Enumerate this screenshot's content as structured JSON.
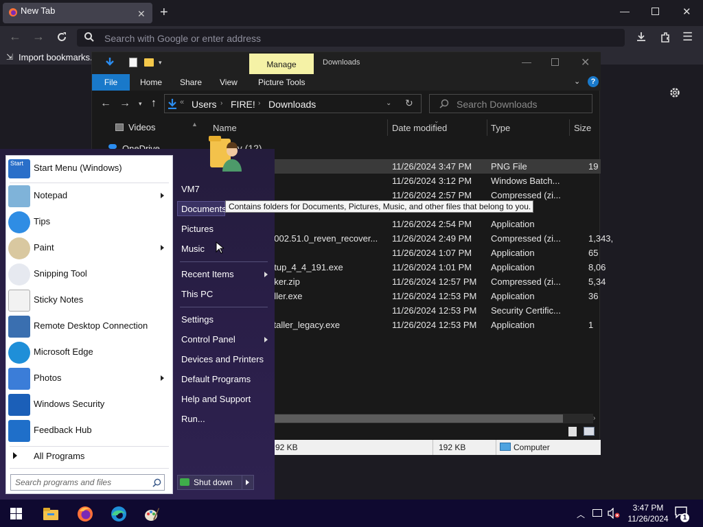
{
  "browser": {
    "tab_title": "New Tab",
    "url_placeholder": "Search with Google or enter address",
    "bookmark": "Import bookmarks..."
  },
  "explorer": {
    "ribbon_context": "Manage",
    "title": "Downloads",
    "tabs": [
      "File",
      "Home",
      "Share",
      "View",
      "Picture Tools"
    ],
    "breadcrumb": [
      "Users",
      "FIRE!",
      "Downloads"
    ],
    "search_placeholder": "Search Downloads",
    "nav": [
      "Videos",
      "OneDrive"
    ],
    "columns": [
      "Name",
      "Date modified",
      "Type",
      "Size"
    ],
    "group_header": "ay (12)",
    "files": [
      {
        "name": "g",
        "date": "11/26/2024 3:47 PM",
        "type": "PNG File",
        "size": "19"
      },
      {
        "name": "",
        "date": "11/26/2024 3:12 PM",
        "type": "Windows Batch...",
        "size": ""
      },
      {
        "name": "",
        "date": "11/26/2024 2:57 PM",
        "type": "Compressed (zi...",
        "size": ""
      },
      {
        "name": "",
        "date": "",
        "type": "",
        "size": ""
      },
      {
        "name": "",
        "date": "11/26/2024 2:54 PM",
        "type": "Application",
        "size": ""
      },
      {
        "name": "6002.51.0_reven_recover...",
        "date": "11/26/2024 2:49 PM",
        "type": "Compressed (zi...",
        "size": "1,343,"
      },
      {
        "name": "",
        "date": "11/26/2024 1:07 PM",
        "type": "Application",
        "size": "65"
      },
      {
        "name": "etup_4_4_191.exe",
        "date": "11/26/2024 1:01 PM",
        "type": "Application",
        "size": "8,06"
      },
      {
        "name": "aker.zip",
        "date": "11/26/2024 12:57 PM",
        "type": "Compressed (zi...",
        "size": "5,34"
      },
      {
        "name": "aller.exe",
        "date": "11/26/2024 12:53 PM",
        "type": "Application",
        "size": "36"
      },
      {
        "name": "",
        "date": "11/26/2024 12:53 PM",
        "type": "Security Certific...",
        "size": ""
      },
      {
        "name": "staller_legacy.exe",
        "date": "11/26/2024 12:53 PM",
        "type": "Application",
        "size": "1"
      }
    ],
    "status_size1": "92 KB",
    "status_size2": "192 KB",
    "status_location": "Computer"
  },
  "start_menu": {
    "pinned": [
      {
        "label": "Start Menu (Windows)",
        "icon": "start-menu-icon",
        "arrow": false
      },
      {
        "label": "Notepad",
        "icon": "notepad-icon",
        "arrow": true
      },
      {
        "label": "Tips",
        "icon": "tips-icon",
        "arrow": false
      },
      {
        "label": "Paint",
        "icon": "paint-icon",
        "arrow": true
      },
      {
        "label": "Snipping Tool",
        "icon": "snipping-tool-icon",
        "arrow": false
      },
      {
        "label": "Sticky Notes",
        "icon": "sticky-notes-icon",
        "arrow": false
      },
      {
        "label": "Remote Desktop Connection",
        "icon": "remote-desktop-icon",
        "arrow": false
      },
      {
        "label": "Microsoft Edge",
        "icon": "edge-icon",
        "arrow": false
      },
      {
        "label": "Photos",
        "icon": "photos-icon",
        "arrow": true
      },
      {
        "label": "Windows Security",
        "icon": "windows-security-icon",
        "arrow": false
      },
      {
        "label": "Feedback Hub",
        "icon": "feedback-hub-icon",
        "arrow": false
      }
    ],
    "start_icon_text": "Start",
    "all_programs": "All Programs",
    "search_placeholder": "Search programs and files",
    "right_items": [
      "VM7",
      "Documents",
      "Pictures",
      "Music",
      "Recent Items",
      "This PC",
      "Settings",
      "Control Panel",
      "Devices and Printers",
      "Default Programs",
      "Help and Support",
      "Run..."
    ],
    "shutdown": "Shut down",
    "tooltip": "Contains folders for Documents, Pictures, Music, and other files that belong to you."
  },
  "taskbar": {
    "time": "3:47 PM",
    "date": "11/26/2024",
    "notification_count": "1"
  }
}
